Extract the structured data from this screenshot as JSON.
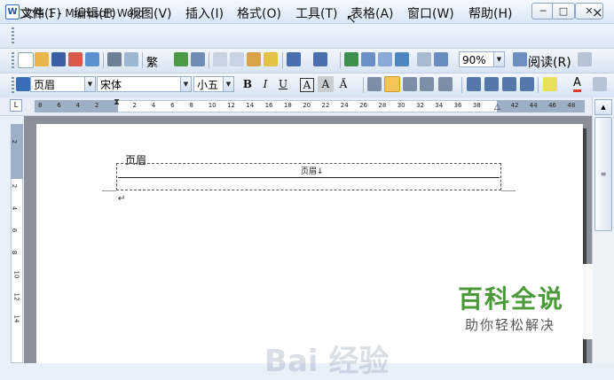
{
  "window": {
    "title": "文档 1 - Microsoft Word",
    "app_icon_letter": "W",
    "minimize_label": "─",
    "maximize_label": "□",
    "close_label": "✕"
  },
  "menu": {
    "items": [
      "文件(F)",
      "编辑(E)",
      "视图(V)",
      "插入(I)",
      "格式(O)",
      "工具(T)",
      "表格(A)",
      "窗口(W)",
      "帮助(H)"
    ],
    "close_label": "×"
  },
  "standard_toolbar": {
    "zoom_value": "90%",
    "read_label": "阅读(R)",
    "traditional_label": "繁"
  },
  "format_toolbar": {
    "style_value": "页眉",
    "font_value": "宋体",
    "size_value": "小五",
    "bold": "B",
    "italic": "I",
    "underline": "U",
    "char_border": "A",
    "char_shading": "A",
    "char_scale": "A̋",
    "font_color_letter": "A"
  },
  "ruler": {
    "ticks": [
      "8",
      "6",
      "4",
      "2",
      "",
      "2",
      "4",
      "6",
      "8",
      "10",
      "12",
      "14",
      "16",
      "18",
      "20",
      "22",
      "24",
      "26",
      "28",
      "30",
      "32",
      "34",
      "36",
      "38",
      "",
      "42",
      "44",
      "46",
      "48"
    ],
    "vertical_ticks": [
      "2",
      "",
      "2",
      "4",
      "6",
      "8",
      "10",
      "12",
      "14"
    ]
  },
  "document": {
    "header_label": "页眉",
    "header_field": "页眉↓",
    "paragraph_mark": "↵"
  },
  "watermark": {
    "title": "百科全说",
    "subtitle": "助你轻松解决",
    "baidu": "Bai 经验"
  }
}
